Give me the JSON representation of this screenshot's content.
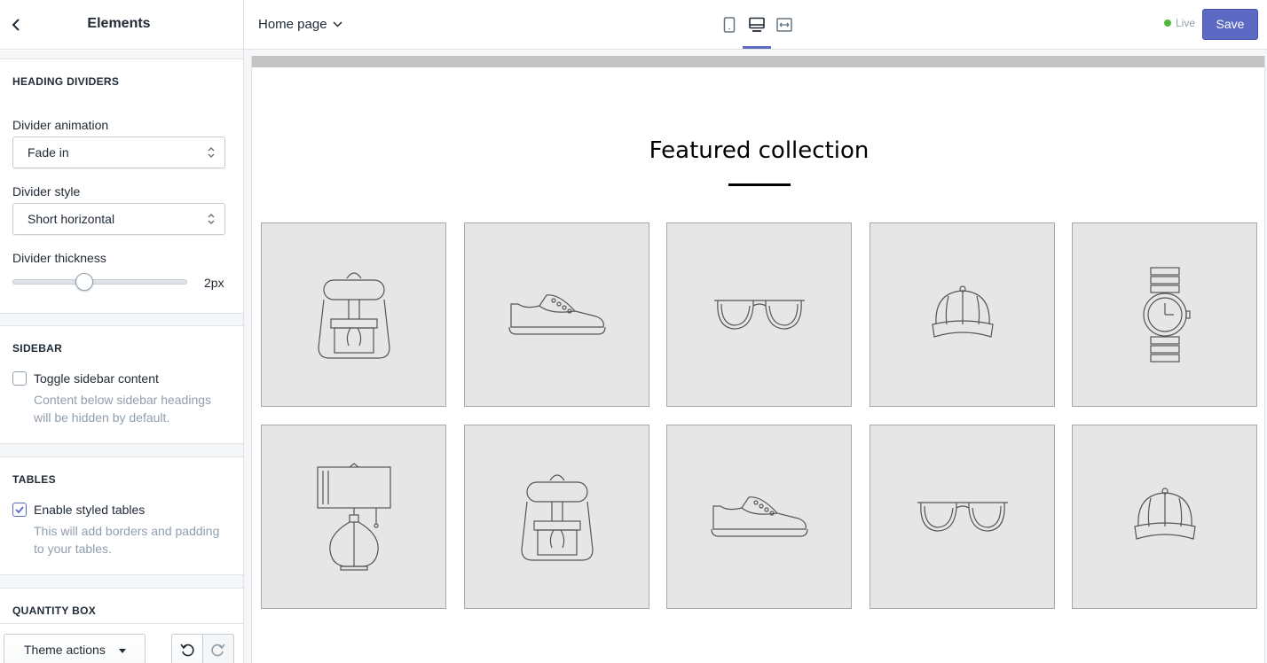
{
  "sidebar": {
    "title": "Elements",
    "sections": {
      "heading_dividers": {
        "title": "HEADING DIVIDERS",
        "animation_label": "Divider animation",
        "animation_value": "Fade in",
        "style_label": "Divider style",
        "style_value": "Short horizontal",
        "thickness_label": "Divider thickness",
        "thickness_value": "2px",
        "thickness_fraction": 0.41
      },
      "sidebar": {
        "title": "SIDEBAR",
        "toggle_label": "Toggle sidebar content",
        "toggle_checked": false,
        "toggle_help": "Content below sidebar headings will be hidden by default."
      },
      "tables": {
        "title": "TABLES",
        "enable_label": "Enable styled tables",
        "enable_checked": true,
        "enable_help": "This will add borders and padding to your tables."
      },
      "quantity_box": {
        "title": "QUANTITY BOX"
      }
    },
    "footer": {
      "theme_actions_label": "Theme actions"
    }
  },
  "topbar": {
    "page_selector": "Home page",
    "devices": [
      "mobile-icon",
      "desktop-icon",
      "fullscreen-icon"
    ],
    "active_device": "desktop-icon",
    "status": "Live",
    "save_label": "Save"
  },
  "preview": {
    "section_title": "Featured collection",
    "products": [
      "backpack-icon",
      "sneaker-icon",
      "sunglasses-icon",
      "cap-icon",
      "watch-icon",
      "lamp-icon",
      "backpack-icon",
      "sneaker-icon",
      "sunglasses-icon",
      "cap-icon"
    ]
  },
  "colors": {
    "accent": "#5c6ac4",
    "live": "#50b83c",
    "tile_bg": "#e6e6e6"
  }
}
